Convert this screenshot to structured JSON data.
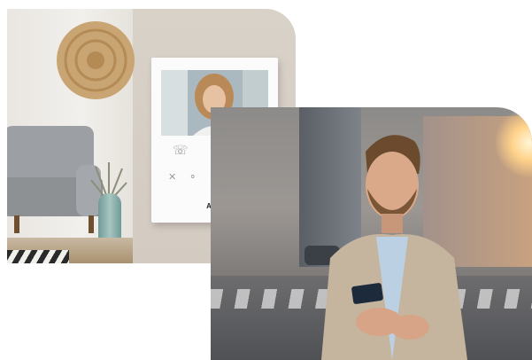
{
  "intercom": {
    "brand_text": "ABB"
  },
  "colors": {
    "panel_white": "#fbfbfb",
    "wall_beige": "#d3cbc1",
    "sofa_grey": "#8e9194",
    "sunset": "#ffd28a"
  },
  "icons": {
    "panel_row1": [
      "phone-icon",
      "lock-icon",
      "camera-icon"
    ],
    "panel_row2": [
      "mute-icon",
      "key-icon",
      "bell-icon",
      "light-icon",
      "settings-icon"
    ]
  }
}
